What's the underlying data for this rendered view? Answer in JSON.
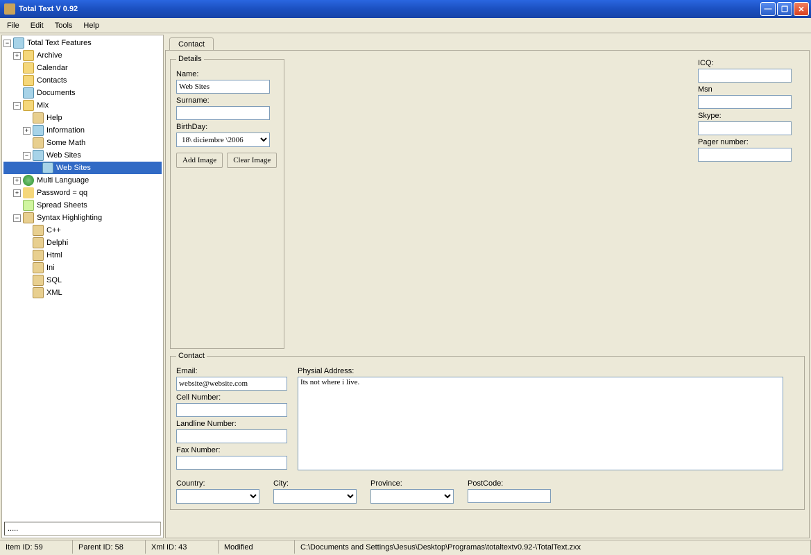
{
  "window": {
    "title": "Total Text V 0.92"
  },
  "menu": {
    "file": "File",
    "edit": "Edit",
    "tools": "Tools",
    "help": "Help"
  },
  "tree": {
    "root": "Total Text Features",
    "archive": "Archive",
    "calendar": "Calendar",
    "contacts": "Contacts",
    "documents": "Documents",
    "mix": "Mix",
    "help": "Help",
    "information": "Information",
    "some_math": "Some Math",
    "web_sites": "Web Sites",
    "web_sites_child": "Web Sites",
    "multi_language": "Multi Language",
    "password": "Password = qq",
    "spread_sheets": "Spread Sheets",
    "syntax": "Syntax Highlighting",
    "cpp": "C++",
    "delphi": "Delphi",
    "html": "Html",
    "ini": "Ini",
    "sql": "SQL",
    "xml": "XML"
  },
  "search": {
    "value": "....."
  },
  "tabs": {
    "contact": "Contact"
  },
  "details": {
    "legend": "Details",
    "name_label": "Name:",
    "name_value": "Web Sites",
    "surname_label": "Surname:",
    "surname_value": "",
    "birthday_label": "BirthDay:",
    "birthday_value": "18\\ diciembre \\2006",
    "add_image": "Add Image",
    "clear_image": "Clear Image"
  },
  "im": {
    "icq_label": "ICQ:",
    "icq_value": "",
    "msn_label": "Msn",
    "msn_value": "",
    "skype_label": "Skype:",
    "skype_value": "",
    "pager_label": "Pager number:",
    "pager_value": ""
  },
  "contact": {
    "legend": "Contact",
    "email_label": "Email:",
    "email_value": "website@website.com",
    "cell_label": "Cell Number:",
    "cell_value": "",
    "landline_label": "Landline Number:",
    "landline_value": "",
    "fax_label": "Fax Number:",
    "fax_value": "",
    "addr_label": "Physial Address:",
    "addr_value": "Its not where i live.",
    "country_label": "Country:",
    "country_value": "",
    "city_label": "City:",
    "city_value": "",
    "province_label": "Province:",
    "province_value": "",
    "postcode_label": "PostCode:",
    "postcode_value": ""
  },
  "status": {
    "item_id": "Item ID: 59",
    "parent_id": "Parent ID: 58",
    "xml_id": "Xml ID: 43",
    "modified": "Modified",
    "path": "C:\\Documents and Settings\\Jesus\\Desktop\\Programas\\totaltextv0.92-\\TotalText.zxx"
  }
}
